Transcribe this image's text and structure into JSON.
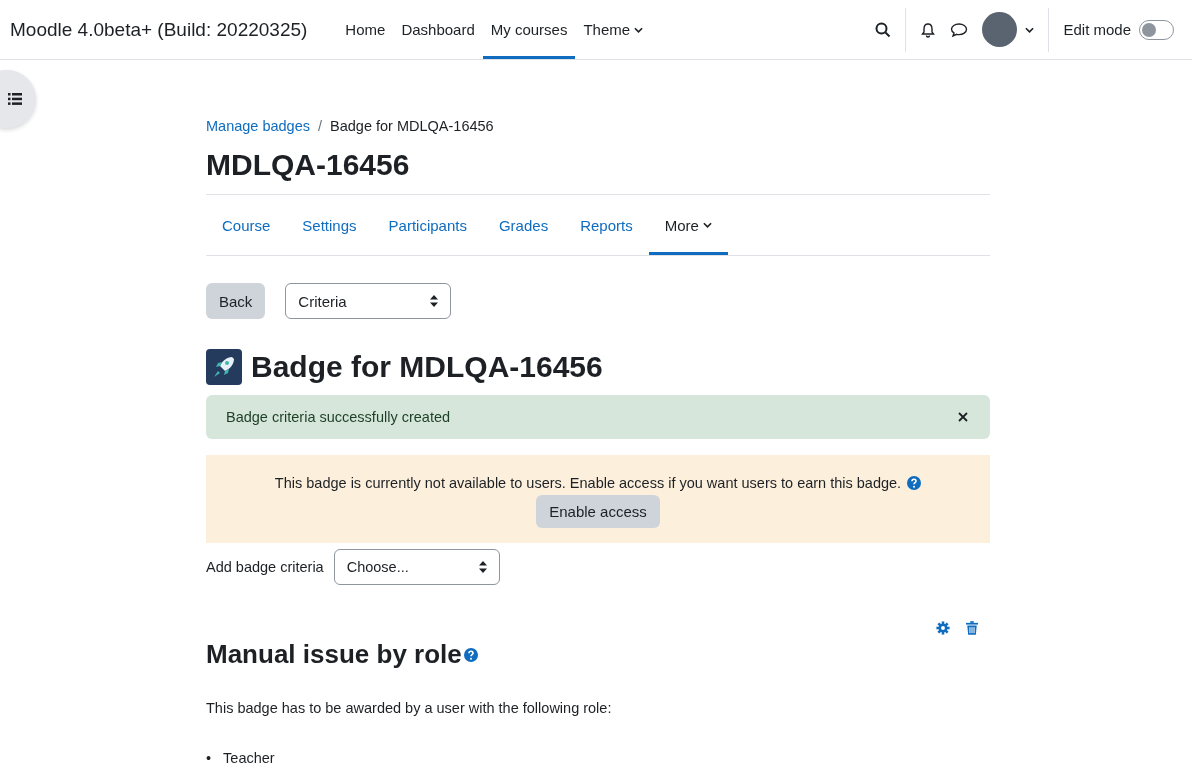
{
  "navbar": {
    "site_name": "Moodle 4.0beta+ (Build: 20220325)",
    "nav": [
      {
        "label": "Home",
        "selected": false,
        "dropdown": false
      },
      {
        "label": "Dashboard",
        "selected": false,
        "dropdown": false
      },
      {
        "label": "My courses",
        "selected": true,
        "dropdown": false
      },
      {
        "label": "Theme",
        "selected": false,
        "dropdown": true
      }
    ],
    "edit_mode": {
      "label": "Edit mode",
      "on": false
    }
  },
  "breadcrumb": {
    "separator": "/",
    "items": [
      {
        "label": "Manage badges",
        "link": true
      },
      {
        "label": "Badge for MDLQA-16456",
        "link": false
      }
    ]
  },
  "page_title": "MDLQA-16456",
  "course_tabs": [
    {
      "label": "Course",
      "selected": false,
      "dropdown": false
    },
    {
      "label": "Settings",
      "selected": false,
      "dropdown": false
    },
    {
      "label": "Participants",
      "selected": false,
      "dropdown": false
    },
    {
      "label": "Grades",
      "selected": false,
      "dropdown": false
    },
    {
      "label": "Reports",
      "selected": false,
      "dropdown": false
    },
    {
      "label": "More",
      "selected": true,
      "dropdown": true
    }
  ],
  "action_bar": {
    "back_button": "Back",
    "select": "Criteria"
  },
  "badge_title": "Badge for MDLQA-16456",
  "success_alert": {
    "message": "Badge criteria successfully created"
  },
  "warning_alert": {
    "message": "This badge is currently not available to users. Enable access if you want users to earn this badge.",
    "button": "Enable access"
  },
  "add_criteria": {
    "label": "Add badge criteria",
    "select": "Choose..."
  },
  "criterion": {
    "title": "Manual issue by role",
    "description": "This badge has to be awarded by a user with the following role:",
    "bullet": "•",
    "roles": [
      "Teacher"
    ]
  }
}
